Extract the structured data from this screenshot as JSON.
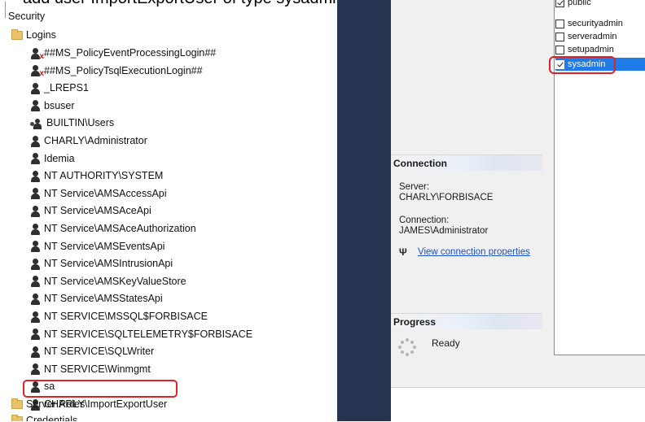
{
  "caption": "add user ImportExportUser of type sysadmin under Security > Log",
  "tree": {
    "security_label": "Security",
    "logins_label": "Logins",
    "logins": [
      {
        "label": "##MS_PolicyEventProcessingLogin##",
        "icon": "user-disabled-icon"
      },
      {
        "label": "##MS_PolicyTsqlExecutionLogin##",
        "icon": "user-disabled-icon"
      },
      {
        "label": "_LREPS1",
        "icon": "user-icon"
      },
      {
        "label": "bsuser",
        "icon": "user-icon"
      },
      {
        "label": "BUILTIN\\Users",
        "icon": "group-icon"
      },
      {
        "label": "CHARLY\\Administrator",
        "icon": "user-icon"
      },
      {
        "label": "Idemia",
        "icon": "user-icon"
      },
      {
        "label": "NT AUTHORITY\\SYSTEM",
        "icon": "user-icon"
      },
      {
        "label": "NT Service\\AMSAccessApi",
        "icon": "user-icon"
      },
      {
        "label": "NT Service\\AMSAceApi",
        "icon": "user-icon"
      },
      {
        "label": "NT Service\\AMSAceAuthorization",
        "icon": "user-icon"
      },
      {
        "label": "NT Service\\AMSEventsApi",
        "icon": "user-icon"
      },
      {
        "label": "NT Service\\AMSIntrusionApi",
        "icon": "user-icon"
      },
      {
        "label": "NT Service\\AMSKeyValueStore",
        "icon": "user-icon"
      },
      {
        "label": "NT Service\\AMSStatesApi",
        "icon": "user-icon"
      },
      {
        "label": "NT SERVICE\\MSSQL$FORBISACE",
        "icon": "user-icon"
      },
      {
        "label": "NT SERVICE\\SQLTELEMETRY$FORBISACE",
        "icon": "user-icon"
      },
      {
        "label": "NT SERVICE\\SQLWriter",
        "icon": "user-icon"
      },
      {
        "label": "NT SERVICE\\Winmgmt",
        "icon": "user-icon"
      },
      {
        "label": "sa",
        "icon": "user-icon"
      },
      {
        "label": "CHARLY\\ImportExportUser",
        "icon": "user-icon"
      }
    ],
    "server_roles_label": "Server Roles",
    "credentials_label": "Credentials"
  },
  "connection": {
    "header": "Connection",
    "server_label": "Server:",
    "server_value": "CHARLY\\FORBISACE",
    "connection_label": "Connection:",
    "connection_value": "JAMES\\Administrator",
    "view_properties_link": "View connection properties"
  },
  "progress": {
    "header": "Progress",
    "status": "Ready"
  },
  "server_roles": [
    {
      "label": "public",
      "checked": true,
      "selected": false
    },
    {
      "label": "securityadmin",
      "checked": false,
      "selected": false
    },
    {
      "label": "serveradmin",
      "checked": false,
      "selected": false
    },
    {
      "label": "setupadmin",
      "checked": false,
      "selected": false
    },
    {
      "label": "sysadmin",
      "checked": true,
      "selected": true
    }
  ],
  "colors": {
    "navy_panel": "#243451",
    "selection": "#1e7be8",
    "highlight": "#e0232b",
    "link": "#1a4fd1"
  }
}
